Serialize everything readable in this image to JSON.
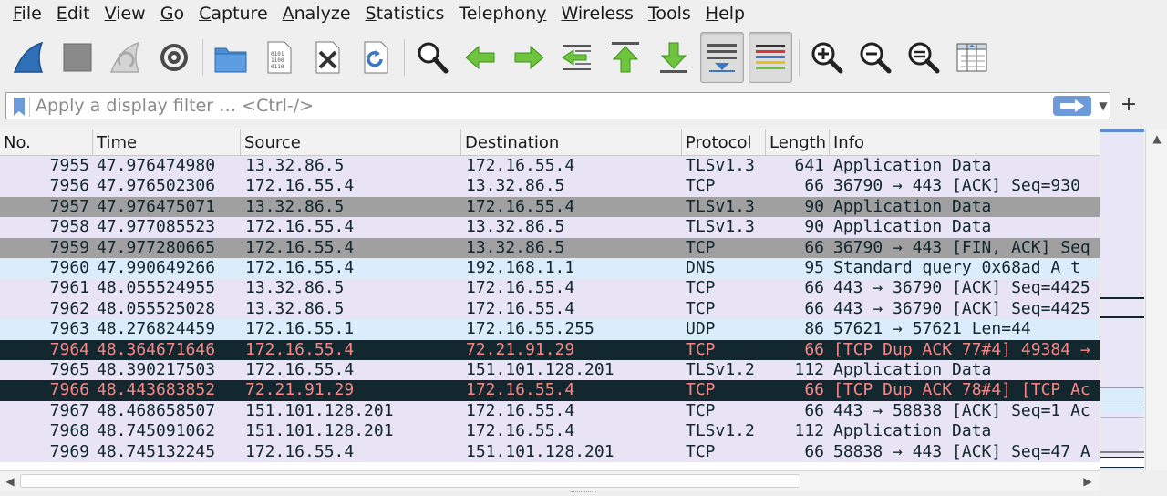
{
  "menu": [
    {
      "label": "File",
      "mnemonic": "F",
      "rest": "ile"
    },
    {
      "label": "Edit",
      "mnemonic": "E",
      "rest": "dit"
    },
    {
      "label": "View",
      "mnemonic": "V",
      "rest": "iew"
    },
    {
      "label": "Go",
      "mnemonic": "G",
      "rest": "o"
    },
    {
      "label": "Capture",
      "mnemonic": "C",
      "rest": "apture"
    },
    {
      "label": "Analyze",
      "mnemonic": "A",
      "rest": "nalyze"
    },
    {
      "label": "Statistics",
      "mnemonic": "S",
      "rest": "tatistics"
    },
    {
      "label": "Telephony",
      "mnemonic": "",
      "rest": "Telephony",
      "ul_index": 8
    },
    {
      "label": "Wireless",
      "mnemonic": "W",
      "rest": "ireless"
    },
    {
      "label": "Tools",
      "mnemonic": "T",
      "rest": "ools"
    },
    {
      "label": "Help",
      "mnemonic": "H",
      "rest": "elp"
    }
  ],
  "toolbar": {
    "icons": [
      "shark-fin-start-icon",
      "stop-square-icon",
      "restart-fin-icon",
      "capture-options-gear-icon",
      "open-folder-icon",
      "file-binary-icon",
      "close-file-icon",
      "reload-file-icon",
      "find-magnifier-icon",
      "go-back-arrow-icon",
      "go-forward-arrow-icon",
      "go-to-packet-icon",
      "go-first-packet-icon",
      "go-last-packet-icon",
      "autoscroll-icon",
      "colorize-icon",
      "zoom-in-icon",
      "zoom-out-icon",
      "zoom-normal-icon",
      "resize-columns-icon"
    ]
  },
  "filter": {
    "placeholder": "Apply a display filter … <Ctrl-/>",
    "add_label": "+"
  },
  "columns": [
    "No.",
    "Time",
    "Source",
    "Destination",
    "Protocol",
    "Length",
    "Info"
  ],
  "packets": [
    {
      "no": "7955",
      "time": "47.976474980",
      "src": "13.32.86.5",
      "dst": "172.16.55.4",
      "proto": "TLSv1.3",
      "len": "641",
      "info": "Application Data",
      "style": "tls"
    },
    {
      "no": "7956",
      "time": "47.976502306",
      "src": "172.16.55.4",
      "dst": "13.32.86.5",
      "proto": "TCP",
      "len": "66",
      "info": "36790 → 443 [ACK] Seq=930",
      "style": "tcp"
    },
    {
      "no": "7957",
      "time": "47.976475071",
      "src": "13.32.86.5",
      "dst": "172.16.55.4",
      "proto": "TLSv1.3",
      "len": "90",
      "info": "Application Data",
      "style": "sel"
    },
    {
      "no": "7958",
      "time": "47.977085523",
      "src": "172.16.55.4",
      "dst": "13.32.86.5",
      "proto": "TLSv1.3",
      "len": "90",
      "info": "Application Data",
      "style": "tls"
    },
    {
      "no": "7959",
      "time": "47.977280665",
      "src": "172.16.55.4",
      "dst": "13.32.86.5",
      "proto": "TCP",
      "len": "66",
      "info": "36790 → 443 [FIN, ACK] Seq",
      "style": "sel"
    },
    {
      "no": "7960",
      "time": "47.990649266",
      "src": "172.16.55.4",
      "dst": "192.168.1.1",
      "proto": "DNS",
      "len": "95",
      "info": "Standard query 0x68ad A t",
      "style": "dns"
    },
    {
      "no": "7961",
      "time": "48.055524955",
      "src": "13.32.86.5",
      "dst": "172.16.55.4",
      "proto": "TCP",
      "len": "66",
      "info": "443 → 36790 [ACK] Seq=4425",
      "style": "tcp"
    },
    {
      "no": "7962",
      "time": "48.055525028",
      "src": "13.32.86.5",
      "dst": "172.16.55.4",
      "proto": "TCP",
      "len": "66",
      "info": "443 → 36790 [ACK] Seq=4425",
      "style": "tcp"
    },
    {
      "no": "7963",
      "time": "48.276824459",
      "src": "172.16.55.1",
      "dst": "172.16.55.255",
      "proto": "UDP",
      "len": "86",
      "info": "57621 → 57621 Len=44",
      "style": "udp"
    },
    {
      "no": "7964",
      "time": "48.364671646",
      "src": "172.16.55.4",
      "dst": "72.21.91.29",
      "proto": "TCP",
      "len": "66",
      "info": "[TCP Dup ACK 77#4] 49384 →",
      "style": "bad"
    },
    {
      "no": "7965",
      "time": "48.390217503",
      "src": "172.16.55.4",
      "dst": "151.101.128.201",
      "proto": "TLSv1.2",
      "len": "112",
      "info": "Application Data",
      "style": "tls"
    },
    {
      "no": "7966",
      "time": "48.443683852",
      "src": "72.21.91.29",
      "dst": "172.16.55.4",
      "proto": "TCP",
      "len": "66",
      "info": "[TCP Dup ACK 78#4] [TCP Ac",
      "style": "bad"
    },
    {
      "no": "7967",
      "time": "48.468658507",
      "src": "151.101.128.201",
      "dst": "172.16.55.4",
      "proto": "TCP",
      "len": "66",
      "info": "443 → 58838 [ACK] Seq=1 Ac",
      "style": "tcp"
    },
    {
      "no": "7968",
      "time": "48.745091062",
      "src": "151.101.128.201",
      "dst": "172.16.55.4",
      "proto": "TLSv1.2",
      "len": "112",
      "info": "Application Data",
      "style": "tls"
    },
    {
      "no": "7969",
      "time": "48.745132245",
      "src": "172.16.55.4",
      "dst": "151.101.128.201",
      "proto": "TCP",
      "len": "66",
      "info": "58838 → 443 [ACK] Seq=47 A",
      "style": "tcp"
    }
  ],
  "colors": {
    "tcp_row": "#e8e4f6",
    "dns_row": "#dbecfb",
    "selected_row": "#a0a0a0",
    "bad_row_bg": "#12272e",
    "bad_row_fg": "#f78787",
    "apply_button": "#6f9ad8"
  }
}
